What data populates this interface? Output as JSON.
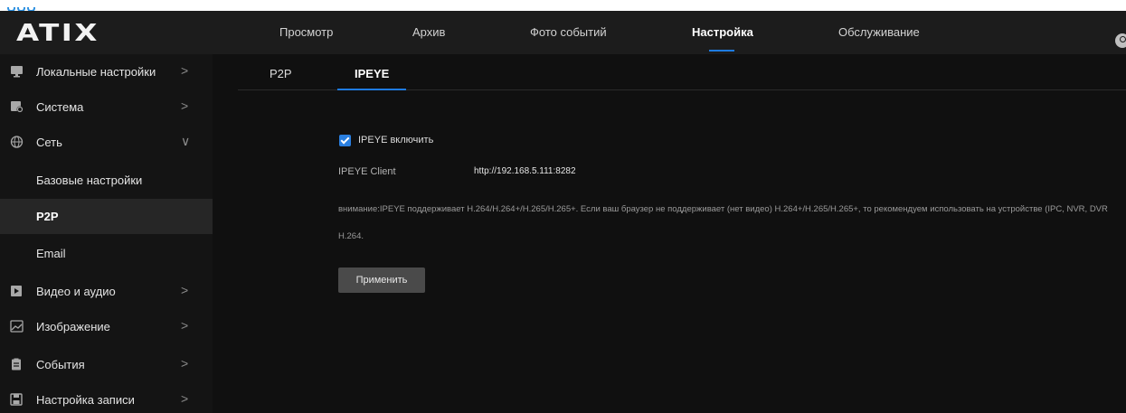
{
  "app": {
    "logo": "ATIX"
  },
  "nav": {
    "items": [
      {
        "label": "Просмотр"
      },
      {
        "label": "Архив"
      },
      {
        "label": "Фото событий"
      },
      {
        "label": "Настройка",
        "active": true
      },
      {
        "label": "Обслуживание"
      }
    ],
    "user_icon": "user-icon"
  },
  "sidebar": {
    "items": [
      {
        "label": "Локальные настройки",
        "icon": "monitor-icon",
        "chevron": ">"
      },
      {
        "label": "Система",
        "icon": "system-settings-icon",
        "chevron": ">"
      },
      {
        "label": "Сеть",
        "icon": "network-globe-icon",
        "chevron": "∨"
      },
      {
        "label": "Базовые настройки"
      },
      {
        "label": "P2P",
        "selected": true
      },
      {
        "label": "Email"
      },
      {
        "label": "Видео и аудио",
        "icon": "video-play-icon",
        "chevron": ">"
      },
      {
        "label": "Изображение",
        "icon": "image-icon",
        "chevron": ">"
      },
      {
        "label": "События",
        "icon": "clipboard-icon",
        "chevron": ">"
      },
      {
        "label": "Настройка записи",
        "icon": "save-disk-icon",
        "chevron": ">"
      }
    ]
  },
  "main": {
    "tabs": [
      {
        "label": "P2P"
      },
      {
        "label": "IPEYE",
        "active": true
      }
    ],
    "enable_checkbox": {
      "label": "IPEYE включить",
      "checked": true
    },
    "client": {
      "label": "IPEYE Client",
      "value": "http://192.168.5.111:8282"
    },
    "notice_line1": "внимание:IPEYE поддерживает H.264/H.264+/H.265/H.265+. Если ваш браузер не поддерживает (нет видео) H.264+/H.265/H.265+, то рекомендуем использовать на устройстве (IPC, NVR, DVR",
    "notice_line2": "H.264.",
    "apply_label": "Применить"
  },
  "colors": {
    "accent": "#1e7be0",
    "topbar": "#1c1c1c",
    "sidebar": "#141414",
    "main": "#101010"
  }
}
